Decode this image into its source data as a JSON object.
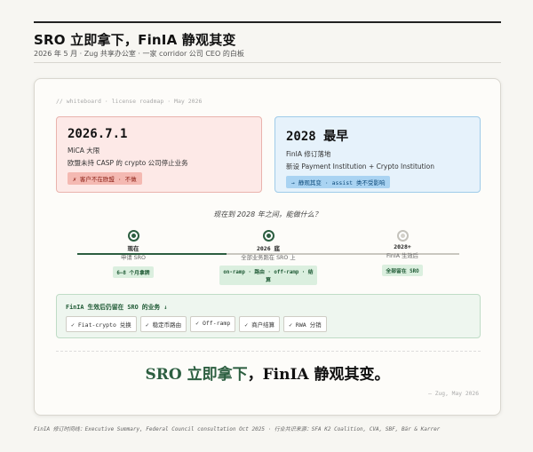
{
  "header": {
    "title": "SRO 立即拿下，FinIA 静观其变",
    "subtitle": "2026 年 5 月 · Zug 共享办公室 · 一家 corridor 公司 CEO 的白板"
  },
  "board": {
    "breadcrumb": "// whiteboard · license roadmap · May 2026",
    "card_left": {
      "date": "2026.7.1",
      "line1": "MiCA 大限",
      "line2": "欧盟未持 CASP 的 crypto 公司停止业务",
      "tag": "✗ 客户不在欧盟 · 不做"
    },
    "card_right": {
      "date": "2028 最早",
      "line1": "FinIA 修订落地",
      "line2": "新设 Payment Institution + Crypto Institution",
      "tag": "→ 静观其变 · assist 类不受影响"
    },
    "question": "现在到 2028 年之间，能做什么？",
    "timeline": [
      {
        "title": "现在",
        "desc": "申请 SRO",
        "tag": "6–8 个月拿牌"
      },
      {
        "title": "2026 底",
        "desc": "全部业务跑在 SRO 上",
        "tag": "on-ramp · 路由 · off-ramp · 结算"
      },
      {
        "title": "2028+",
        "desc": "FinIA 生效后",
        "tag": "全部留在 SRO"
      }
    ],
    "remain": {
      "title": "FinIA 生效后仍留在 SRO 的业务 ↓",
      "chips": [
        "✓ Fiat-crypto 兑换",
        "✓ 稳定币路由",
        "✓ Off-ramp",
        "✓ 商户结算",
        "✓ RWA 分销"
      ]
    },
    "slogan_highlight": "SRO 立即拿下",
    "slogan_rest": "，FinIA 静观其变。",
    "signature": "— Zug, May 2026"
  },
  "footer": "FinIA 修订时间线：Executive Summary, Federal Council consultation Oct 2025 · 行业共识来源：SFA K2 Coalition, CVA, SBF, Bär & Karrer",
  "colors": {
    "accent": "#2c5e40",
    "red_card": "#fde9e7",
    "blue_card": "#e6f2fb"
  }
}
